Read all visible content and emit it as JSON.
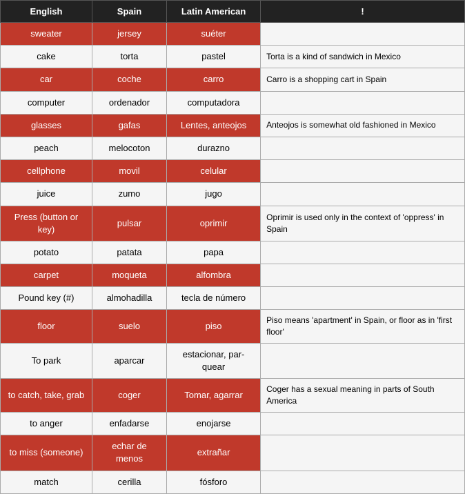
{
  "headers": [
    "English",
    "Spain",
    "Latin American",
    "!"
  ],
  "rows": [
    {
      "english": "sweater",
      "spain": "jersey",
      "latin": "suéter",
      "note": ""
    },
    {
      "english": "cake",
      "spain": "torta",
      "latin": "pastel",
      "note": "Torta is a kind of sandwich in Mexico"
    },
    {
      "english": "car",
      "spain": "coche",
      "latin": "carro",
      "note": "Carro is a shopping cart in Spain"
    },
    {
      "english": "computer",
      "spain": "ordenador",
      "latin": "computadora",
      "note": ""
    },
    {
      "english": "glasses",
      "spain": "gafas",
      "latin": "Lentes, anteojos",
      "note": "Anteojos is somewhat old fashioned in Mexico"
    },
    {
      "english": "peach",
      "spain": "melocoton",
      "latin": "durazno",
      "note": ""
    },
    {
      "english": "cellphone",
      "spain": "movil",
      "latin": "celular",
      "note": ""
    },
    {
      "english": "juice",
      "spain": "zumo",
      "latin": "jugo",
      "note": ""
    },
    {
      "english": "Press (button or key)",
      "spain": "pulsar",
      "latin": "oprimir",
      "note": "Oprimir is used only in the context of 'oppress' in Spain"
    },
    {
      "english": "potato",
      "spain": "patata",
      "latin": "papa",
      "note": ""
    },
    {
      "english": "carpet",
      "spain": "moqueta",
      "latin": "alfombra",
      "note": ""
    },
    {
      "english": "Pound key (#)",
      "spain": "almohadilla",
      "latin": "tecla de número",
      "note": ""
    },
    {
      "english": "floor",
      "spain": "suelo",
      "latin": "piso",
      "note": "Piso means 'apartment' in Spain, or floor as in 'first floor'"
    },
    {
      "english": "To park",
      "spain": "aparcar",
      "latin": "estacionar, par-quear",
      "note": ""
    },
    {
      "english": "to catch, take, grab",
      "spain": "coger",
      "latin": "Tomar, agarrar",
      "note": "Coger has a sexual meaning in parts of South America"
    },
    {
      "english": "to anger",
      "spain": "enfadarse",
      "latin": "enojarse",
      "note": ""
    },
    {
      "english": "to miss (someone)",
      "spain": "echar de menos",
      "latin": "extrañar",
      "note": ""
    },
    {
      "english": "match",
      "spain": "cerilla",
      "latin": "fósforo",
      "note": ""
    }
  ]
}
